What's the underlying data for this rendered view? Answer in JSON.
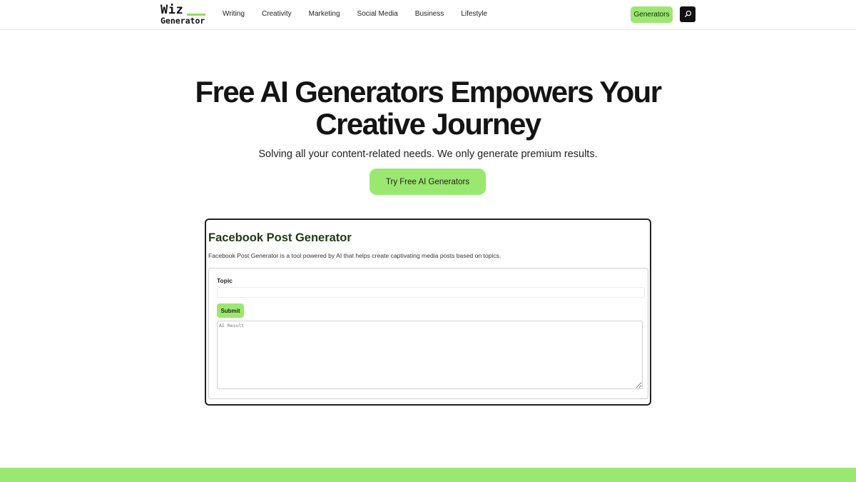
{
  "logo": {
    "top": "Wiz",
    "bottom": "Generator",
    "accent_color": "#8fdc5c"
  },
  "nav": [
    {
      "label": "Writing"
    },
    {
      "label": "Creativity"
    },
    {
      "label": "Marketing"
    },
    {
      "label": "Social Media"
    },
    {
      "label": "Business"
    },
    {
      "label": "Lifestyle"
    }
  ],
  "header": {
    "generators_label": "Generators",
    "search_icon": "search-icon"
  },
  "hero": {
    "title_line1": "Free AI Generators Empowers Your",
    "title_line2": "Creative Journey",
    "subtitle": "Solving all your content-related needs. We only generate premium results.",
    "cta_label": "Try Free AI Generators"
  },
  "tool": {
    "title": "Facebook Post Generator",
    "description": "Facebook Post Generator is a tool powered by AI that helps create captivating media posts based on topics.",
    "topic_label": "Topic",
    "topic_value": "",
    "submit_label": "Submit",
    "result_placeholder": "AI Result"
  },
  "colors": {
    "accent": "#9be870",
    "text": "#141414",
    "tool_title": "#1c3a14"
  }
}
